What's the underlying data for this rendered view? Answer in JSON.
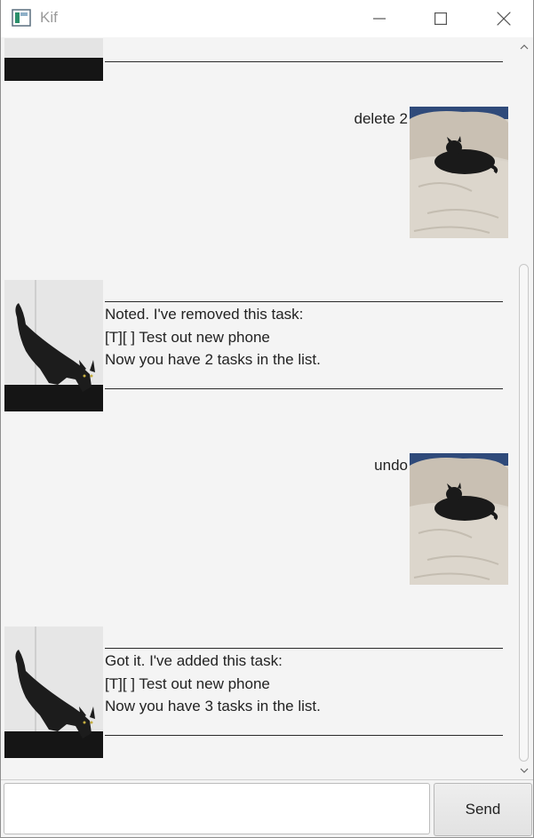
{
  "window": {
    "title": "Kif",
    "icon": "app-window-icon",
    "controls": [
      "minimize-icon",
      "maximize-icon",
      "close-icon"
    ]
  },
  "conversation": [
    {
      "from": "bot",
      "partial": true,
      "avatar": "black-cat-standing-image"
    },
    {
      "from": "user",
      "text": "delete 2",
      "avatar": "black-cat-on-bed-image"
    },
    {
      "from": "bot",
      "lines": [
        "Noted. I've removed this task:",
        "[T][ ] Test out new phone",
        "Now you have 2 tasks in the list."
      ],
      "avatar": "black-cat-standing-image"
    },
    {
      "from": "user",
      "text": "undo",
      "avatar": "black-cat-on-bed-image"
    },
    {
      "from": "bot",
      "lines": [
        "Got it. I've added this task:",
        "[T][ ] Test out new phone",
        "Now you have 3 tasks in the list."
      ],
      "avatar": "black-cat-standing-image"
    }
  ],
  "input": {
    "value": "",
    "placeholder": ""
  },
  "send_label": "Send",
  "colors": {
    "background": "#f4f4f4",
    "titlebar": "#ffffff",
    "text": "#222222"
  }
}
